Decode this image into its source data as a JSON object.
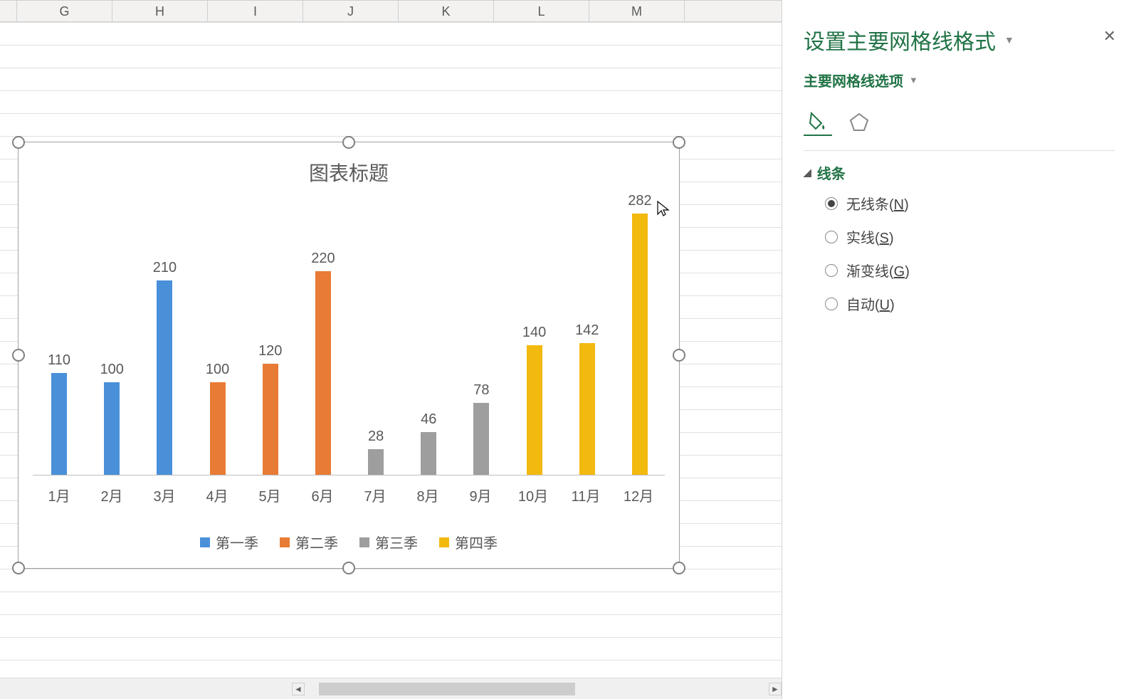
{
  "columns": [
    "G",
    "H",
    "I",
    "J",
    "K",
    "L",
    "M"
  ],
  "chart_data": {
    "type": "bar",
    "title": "图表标题",
    "categories": [
      "1月",
      "2月",
      "3月",
      "4月",
      "5月",
      "6月",
      "7月",
      "8月",
      "9月",
      "10月",
      "11月",
      "12月"
    ],
    "series": [
      {
        "name": "第一季",
        "color": "#4A90D9",
        "months": [
          0,
          1,
          2
        ],
        "values": [
          110,
          100,
          210
        ]
      },
      {
        "name": "第二季",
        "color": "#E87B35",
        "months": [
          3,
          4,
          5
        ],
        "values": [
          100,
          120,
          220
        ]
      },
      {
        "name": "第三季",
        "color": "#9E9E9E",
        "months": [
          6,
          7,
          8
        ],
        "values": [
          28,
          46,
          78
        ]
      },
      {
        "name": "第四季",
        "color": "#F2B90F",
        "months": [
          9,
          10,
          11
        ],
        "values": [
          140,
          142,
          282
        ]
      }
    ],
    "ylim": [
      0,
      300
    ]
  },
  "pane": {
    "title": "设置主要网格线格式",
    "subtitle": "主要网格线选项",
    "section": "线条",
    "options": {
      "none": {
        "label": "无线条",
        "accel": "N"
      },
      "solid": {
        "label": "实线",
        "accel": "S"
      },
      "gradient": {
        "label": "渐变线",
        "accel": "G"
      },
      "auto": {
        "label": "自动",
        "accel": "U"
      }
    },
    "selected": "none"
  }
}
